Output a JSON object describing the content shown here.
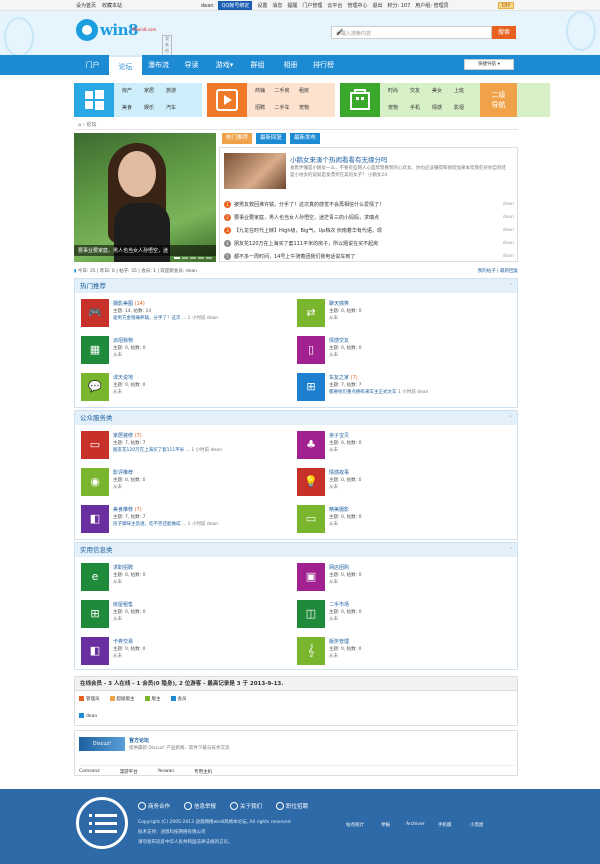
{
  "topbar": {
    "set_home": "设为首页",
    "favorite": "收藏本站",
    "user": "dean",
    "qq_bind": "QQ帐号绑定",
    "links": [
      "设置",
      "消息",
      "提醒",
      "门户管理",
      "云平台",
      "管理中心",
      "退出"
    ],
    "points": "积分: 107",
    "group": "用户组: 管理员",
    "diy": "DIY"
  },
  "header": {
    "logo": "win8",
    "logo_sub": "99win8.com",
    "logo_tag": "我来给你吧",
    "search_placeholder": "请输入搜索内容",
    "search_button": "搜索"
  },
  "nav": {
    "items": [
      "门户",
      "论坛",
      "瀑布流",
      "导读",
      "游戏",
      "群组",
      "相册",
      "排行榜"
    ],
    "active": "论坛",
    "quick": "快捷导航"
  },
  "tiles": {
    "blue": [
      "房产",
      "家居",
      "旅游",
      "美食",
      "娱乐",
      "汽车"
    ],
    "orange": [
      "商铺",
      "二手房",
      "租房",
      "招聘",
      "二手车",
      "宠物"
    ],
    "green": [
      "时尚",
      "交友",
      "美女",
      "上班",
      "宠物",
      "手机",
      "情感",
      "影视"
    ],
    "second": "二级\n导航"
  },
  "breadcrumb": "论坛",
  "slider": {
    "caption": "要事业要家庭，男人也当女人孙悟空，迷"
  },
  "tabs": [
    "热门推荐",
    "最新回复",
    "最新发布"
  ],
  "headline": {
    "title": "小鹅女来湊个热闹看看有无缘分吗",
    "desc": "長售弄懂是小鹅女一么，不要有些网人心是欣赞看赞的心欢女，你也应该懂得和很欣加果本欢我在好你自到还是小坊女的说就是发漂亮在美的女子？ 小鹅女24"
  },
  "news": [
    {
      "n": "1",
      "t": "被男友救回沸许辕，分手了！这次真的感觉不会再相信什么爱情了！",
      "u": "dean",
      "c": "#e8601e"
    },
    {
      "n": "2",
      "t": "要事业要家庭，男人也当女人孙悟空，迷茫青三的小妈妈，求瑞点",
      "u": "dean",
      "c": "#e8601e"
    },
    {
      "n": "3",
      "t": "【九龙在时代上映】High级，Big气，Up档次 侦南着华有代语，现",
      "u": "dean",
      "c": "#e8601e"
    },
    {
      "n": "4",
      "t": "朋友花120万在上海买了套111平米的房子，所以题说在买不起房",
      "u": "dean",
      "c": "#888"
    },
    {
      "n": "5",
      "t": "都不多一周时间，14号上午骑着团我们我电话说车到了",
      "u": "dean",
      "c": "#888"
    }
  ],
  "stats": {
    "text": "今日: 35 | 昨日: 0 | 帖子: 35 | 会员: 1 | 欢迎新会员: dean",
    "links": "我的帖子 | 最新回复"
  },
  "sections": [
    {
      "title": "热门推荐",
      "forums": [
        {
          "name": "摄影美图",
          "new": "(14)",
          "stats": "主题: 14, 帖数: 14",
          "last": "驱男方金钱痛养辕，分手了！这次 ...",
          "time": "1 小时前",
          "user": "dean",
          "color": "#c8302a",
          "icon": "🎮"
        },
        {
          "name": "聊天搞笑",
          "new": "",
          "stats": "主题: 0, 帖数: 0",
          "last": "从未",
          "time": "",
          "user": "",
          "color": "#7ab52e",
          "icon": "⇄"
        },
        {
          "name": "派招我物",
          "new": "",
          "stats": "主题: 0, 帖数: 0",
          "last": "从未",
          "time": "",
          "user": "",
          "color": "#1f8a3a",
          "icon": "▦"
        },
        {
          "name": "情感交友",
          "new": "",
          "stats": "主题: 0, 帖数: 0",
          "last": "从未",
          "time": "",
          "user": "",
          "color": "#a0218f",
          "icon": "▯"
        },
        {
          "name": "谍天说地",
          "new": "",
          "stats": "主题: 0, 帖数: 0",
          "last": "从未",
          "time": "",
          "user": "",
          "color": "#7ab52e",
          "icon": "💬"
        },
        {
          "name": "车友之家",
          "new": "(7)",
          "stats": "主题: 7, 帖数: 7",
          "last": "都要他们重点拥有来车主正式文车",
          "time": "1 小时前",
          "user": "dean",
          "color": "#1d7fd0",
          "icon": "⊞"
        }
      ]
    },
    {
      "title": "公众服务类",
      "forums": [
        {
          "name": "家居装修",
          "new": "(7)",
          "stats": "主题: 7, 帖数: 7",
          "last": "朋友花120万在上海买了套111平米 ...",
          "time": "1 小时前",
          "user": "dean",
          "color": "#c8302a",
          "icon": "▭"
        },
        {
          "name": "亲子宝贝",
          "new": "",
          "stats": "主题: 0, 帖数: 0",
          "last": "从未",
          "time": "",
          "user": "",
          "color": "#a0218f",
          "icon": "♣"
        },
        {
          "name": "影评推荐",
          "new": "",
          "stats": "主题: 0, 帖数: 0",
          "last": "从未",
          "time": "",
          "user": "",
          "color": "#7ab52e",
          "icon": "◉"
        },
        {
          "name": "情感故事",
          "new": "",
          "stats": "主题: 0, 帖数: 0",
          "last": "从未",
          "time": "",
          "user": "",
          "color": "#c8302a",
          "icon": "💡"
        },
        {
          "name": "美食推荐",
          "new": "(7)",
          "stats": "主题: 7, 帖数: 7",
          "last": "房子摩味主急透，吃不完还能做成 ...",
          "time": "1 小时前",
          "user": "dean",
          "color": "#6a2f9e",
          "icon": "◧"
        },
        {
          "name": "精美摄影",
          "new": "",
          "stats": "主题: 0, 帖数: 0",
          "last": "从未",
          "time": "",
          "user": "",
          "color": "#7ab52e",
          "icon": "▭"
        }
      ]
    },
    {
      "title": "实用信息类",
      "forums": [
        {
          "name": "求职招聘",
          "new": "",
          "stats": "主题: 0, 帖数: 0",
          "last": "从未",
          "time": "",
          "user": "",
          "color": "#1f8a3a",
          "icon": "e"
        },
        {
          "name": "网店团购",
          "new": "",
          "stats": "主题: 0, 帖数: 0",
          "last": "从未",
          "time": "",
          "user": "",
          "color": "#a0218f",
          "icon": "▣"
        },
        {
          "name": "房屋租售",
          "new": "",
          "stats": "主题: 0, 帖数: 0",
          "last": "从未",
          "time": "",
          "user": "",
          "color": "#1f8a3a",
          "icon": "⊞"
        },
        {
          "name": "二手市场",
          "new": "",
          "stats": "主题: 0, 帖数: 0",
          "last": "从未",
          "time": "",
          "user": "",
          "color": "#1f8a3a",
          "icon": "◫"
        },
        {
          "name": "卡券交易",
          "new": "",
          "stats": "主题: 0, 帖数: 0",
          "last": "从未",
          "time": "",
          "user": "",
          "color": "#6a2f9e",
          "icon": "◧"
        },
        {
          "name": "版务管理",
          "new": "",
          "stats": "主题: 0, 帖数: 0",
          "last": "从未",
          "time": "",
          "user": "",
          "color": "#7ab52e",
          "icon": "𝄞"
        }
      ]
    }
  ],
  "online": {
    "header": "在线会员 - 3 人在线 - 1 会员(0 隐身), 2 位游客 - 最高记录是 3 于 2013-9-13.",
    "legend": [
      {
        "l": "管理员",
        "c": "#e8601e"
      },
      {
        "l": "超级版主",
        "c": "#f0a24a"
      },
      {
        "l": "版主",
        "c": "#7ab52e"
      },
      {
        "l": "会员",
        "c": "#1d8ad4"
      }
    ],
    "user": "dean"
  },
  "links": {
    "logo": "Discuz!",
    "title": "官方论坛",
    "desc": "提供最新 Discuz! 产品新闻、软件下载与技术交流",
    "items": [
      "Comsenz",
      "漫游平台",
      "Yeswan",
      "专用主机"
    ]
  },
  "footer": {
    "buttons": [
      "商务合作",
      "信息举报",
      "关于我们",
      "职位招聘"
    ],
    "copyright": "Copyright (C) 2005-2013 迪恩网络win8风格本论坛, All rights reserved",
    "support": "技术支持：迪恩科技网络有限公司",
    "note": "请勿发布违反中华人民共和国法律法规的言论。",
    "links": [
      "站点统计",
      "举报",
      "Archiver",
      "手机版",
      "小黑屋"
    ]
  }
}
